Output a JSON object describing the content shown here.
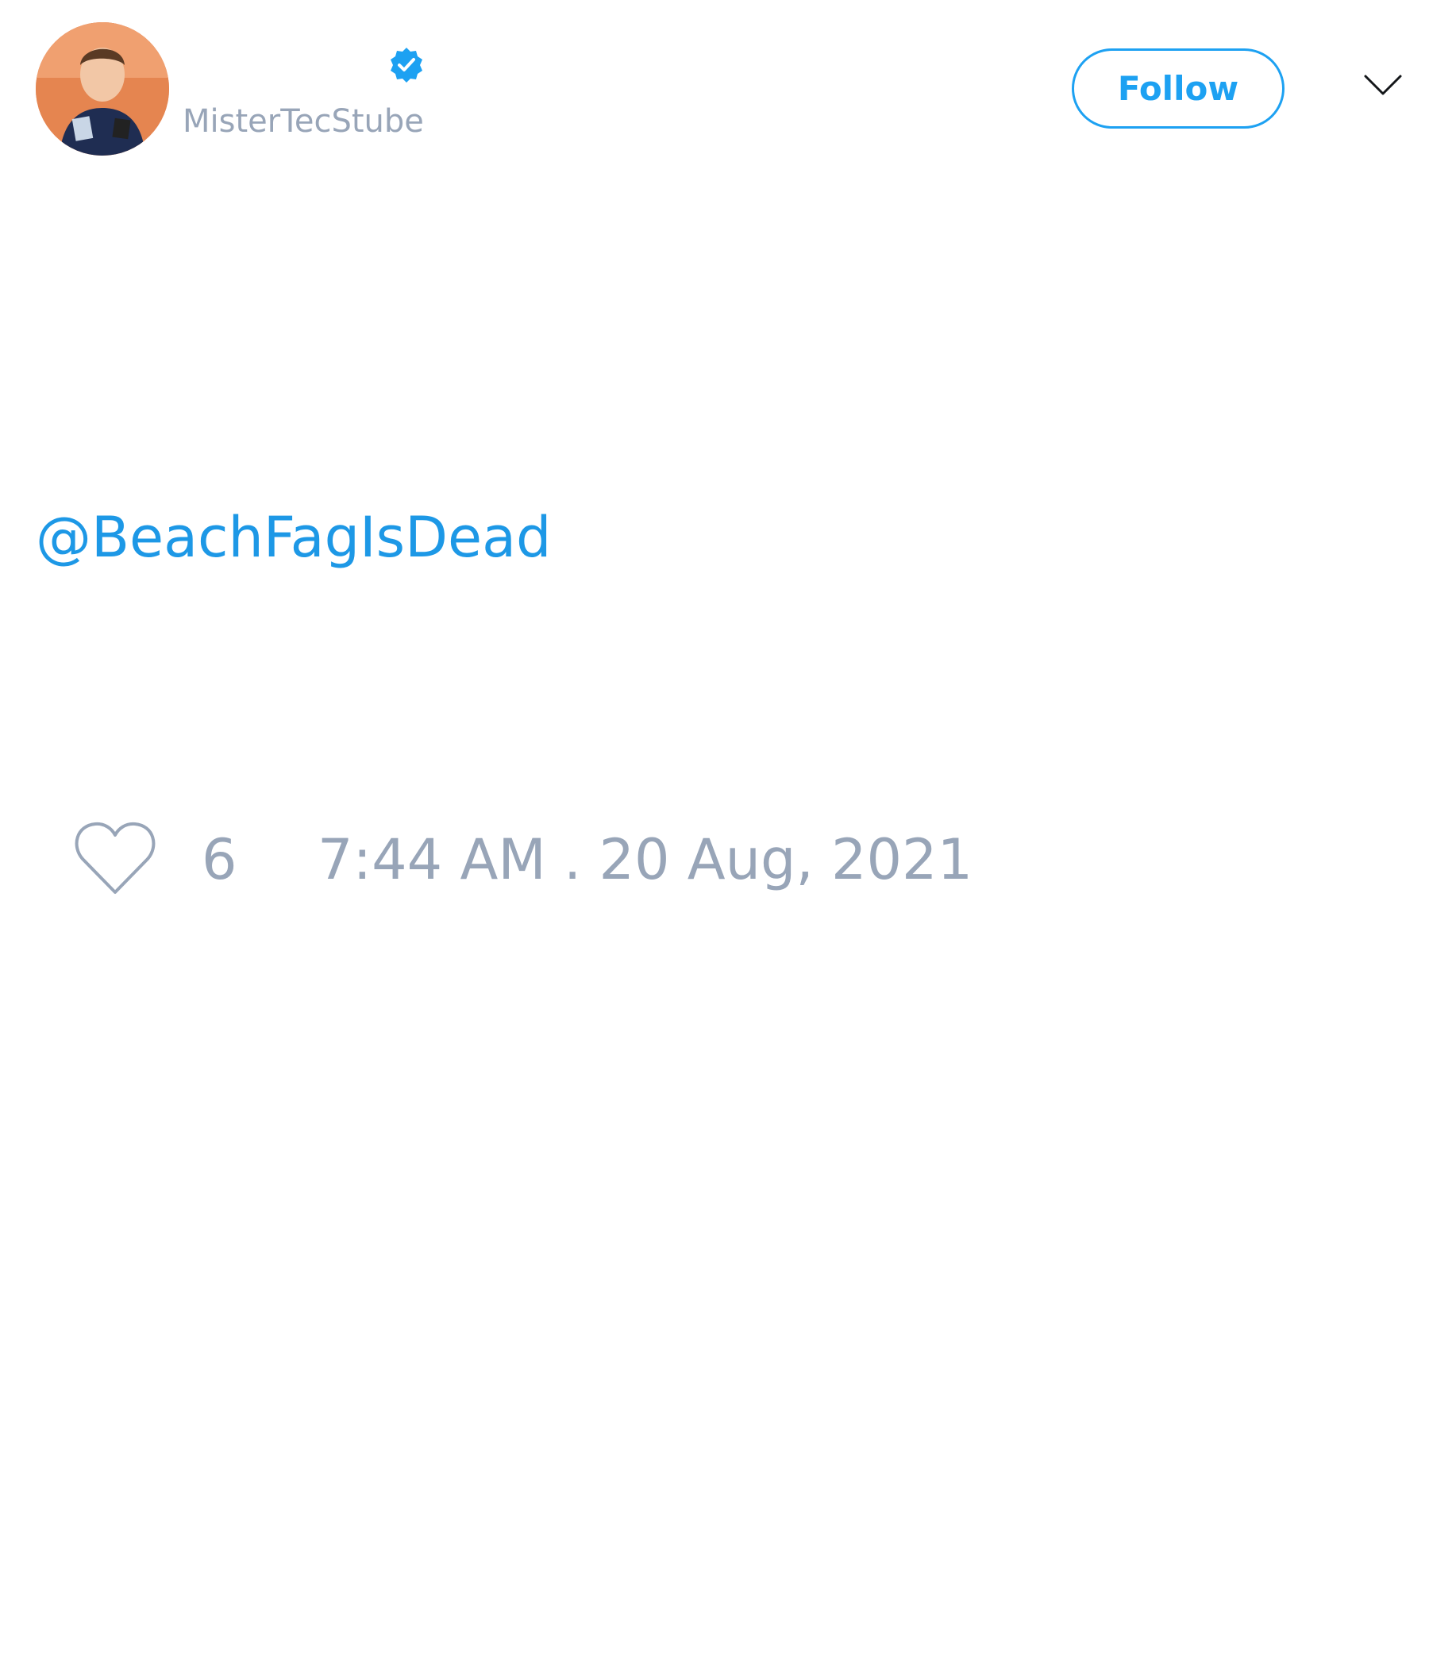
{
  "tweet": {
    "author": {
      "display_name": "",
      "handle": "MisterTecStube",
      "verified": true,
      "avatar_icon": "avatar-photo"
    },
    "follow_label": "Follow",
    "menu_icon": "chevron-down-icon",
    "text": "@BeachFagIsDead",
    "like_icon": "heart-icon",
    "like_count": "6",
    "timestamp": "7:44 AM . 20 Aug, 2021"
  },
  "colors": {
    "accent": "#1da1f2",
    "link": "#1d98e6",
    "muted": "#98a5b8",
    "background": "#ffffff"
  }
}
